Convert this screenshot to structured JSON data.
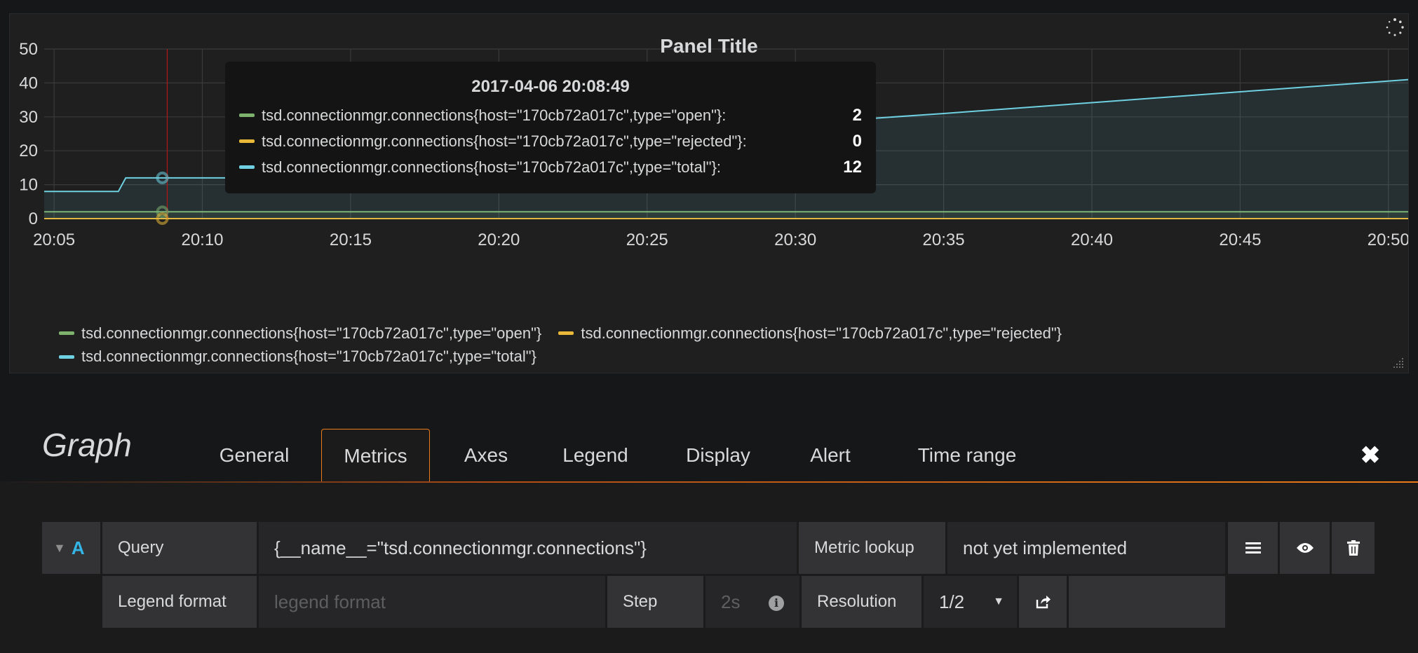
{
  "panel": {
    "title": "Panel Title",
    "tooltip": {
      "time": "2017-04-06 20:08:49",
      "rows": [
        {
          "name": "tsd.connectionmgr.connections{host=\"170cb72a017c\",type=\"open\"}:",
          "value": "2",
          "color": "#7eb26d"
        },
        {
          "name": "tsd.connectionmgr.connections{host=\"170cb72a017c\",type=\"rejected\"}:",
          "value": "0",
          "color": "#eab839"
        },
        {
          "name": "tsd.connectionmgr.connections{host=\"170cb72a017c\",type=\"total\"}:",
          "value": "12",
          "color": "#6ed0e0"
        }
      ]
    },
    "legend": [
      {
        "name": "tsd.connectionmgr.connections{host=\"170cb72a017c\",type=\"open\"}",
        "color": "#7eb26d"
      },
      {
        "name": "tsd.connectionmgr.connections{host=\"170cb72a017c\",type=\"rejected\"}",
        "color": "#eab839"
      },
      {
        "name": "tsd.connectionmgr.connections{host=\"170cb72a017c\",type=\"total\"}",
        "color": "#6ed0e0"
      }
    ]
  },
  "chart_data": {
    "type": "line",
    "title": "Panel Title",
    "xlim": [
      "20:04:40",
      "20:50:40"
    ],
    "ylim": [
      0,
      50
    ],
    "xticks": [
      "20:05",
      "20:10",
      "20:15",
      "20:20",
      "20:25",
      "20:30",
      "20:35",
      "20:40",
      "20:45",
      "20:50"
    ],
    "yticks": [
      0,
      10,
      20,
      30,
      40,
      50
    ],
    "grid": true,
    "legend_position": "bottom",
    "hover_time": "20:08:49",
    "series": [
      {
        "name": "tsd.connectionmgr.connections{host=\"170cb72a017c\",type=\"open\"}",
        "color": "#7eb26d",
        "points": [
          [
            "20:04:40",
            2
          ],
          [
            "20:50:40",
            2
          ]
        ]
      },
      {
        "name": "tsd.connectionmgr.connections{host=\"170cb72a017c\",type=\"rejected\"}",
        "color": "#eab839",
        "points": [
          [
            "20:04:40",
            0
          ],
          [
            "20:50:40",
            0
          ]
        ]
      },
      {
        "name": "tsd.connectionmgr.connections{host=\"170cb72a017c\",type=\"total\"}",
        "color": "#6ed0e0",
        "points": [
          [
            "20:04:40",
            8
          ],
          [
            "20:07:10",
            8
          ],
          [
            "20:07:25",
            12
          ],
          [
            "20:11:40",
            12
          ],
          [
            "20:12:00",
            18
          ],
          [
            "20:16:40",
            18
          ],
          [
            "20:20:10",
            20.5
          ],
          [
            "20:25:00",
            24
          ],
          [
            "20:30:00",
            28
          ],
          [
            "20:35:00",
            31
          ],
          [
            "20:40:00",
            34.2
          ],
          [
            "20:45:00",
            37.4
          ],
          [
            "20:50:40",
            41
          ]
        ]
      }
    ]
  },
  "editor": {
    "title": "Graph",
    "tabs": [
      "General",
      "Metrics",
      "Axes",
      "Legend",
      "Display",
      "Alert",
      "Time range"
    ],
    "active_tab": "Metrics",
    "close_icon": "close-icon",
    "query_row": {
      "ref_id": "A",
      "query_label": "Query",
      "query_value": "{__name__=\"tsd.connectionmgr.connections\"}",
      "metric_lookup_label": "Metric lookup",
      "metric_lookup_value": "not yet implemented"
    },
    "options_row": {
      "legend_format_label": "Legend format",
      "legend_format_placeholder": "legend format",
      "step_label": "Step",
      "step_placeholder": "2s",
      "resolution_label": "Resolution",
      "resolution_value": "1/2"
    },
    "icons": [
      "menu-icon",
      "eye-icon",
      "trash-icon",
      "share-icon",
      "info-icon"
    ]
  }
}
